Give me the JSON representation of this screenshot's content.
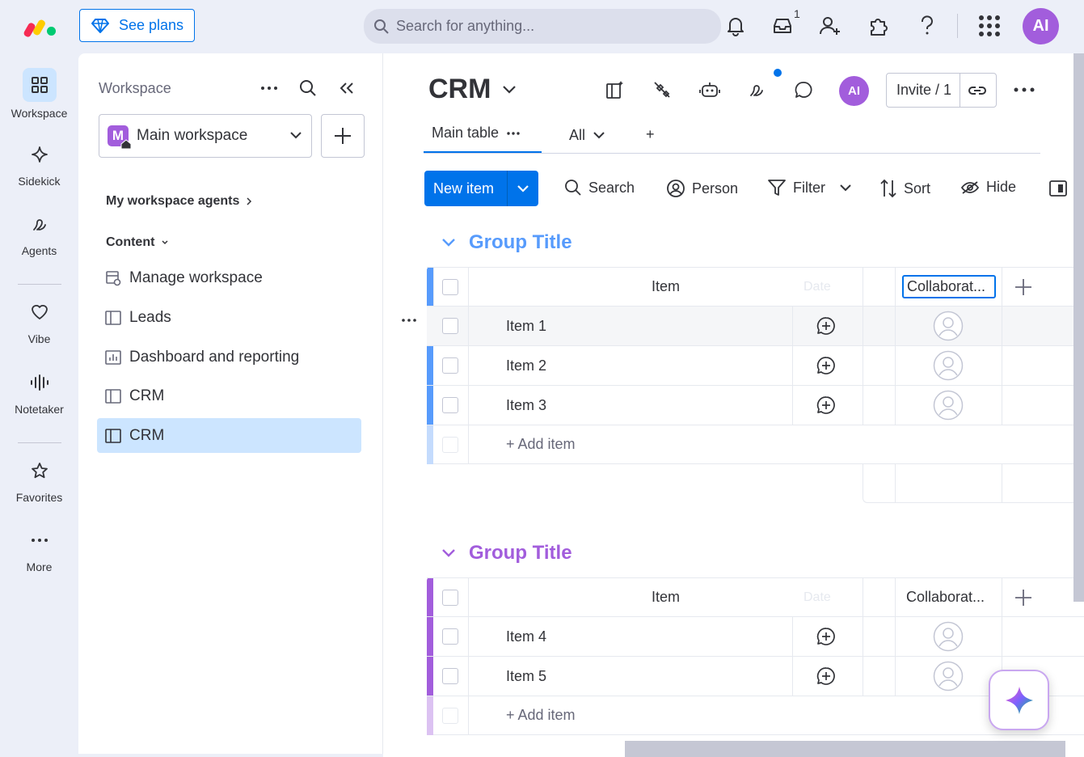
{
  "topbar": {
    "see_plans": "See plans",
    "search_placeholder": "Search for anything...",
    "inbox_badge": "1",
    "avatar_initials": "AI"
  },
  "leftnav": {
    "items": [
      {
        "label": "Workspace",
        "icon": "grid-icon"
      },
      {
        "label": "Sidekick",
        "icon": "sparkle-icon"
      },
      {
        "label": "Agents",
        "icon": "agents-icon"
      },
      {
        "label": "Vibe",
        "icon": "heart-icon"
      },
      {
        "label": "Notetaker",
        "icon": "waveform-icon"
      },
      {
        "label": "Favorites",
        "icon": "star-icon"
      },
      {
        "label": "More",
        "icon": "more-icon"
      }
    ]
  },
  "workspace_panel": {
    "title": "Workspace",
    "selected_workspace": "Main workspace",
    "workspace_initial": "M",
    "agents_link": "My workspace agents",
    "content_label": "Content",
    "tree": [
      {
        "label": "Manage workspace",
        "icon": "manage-icon"
      },
      {
        "label": "Leads",
        "icon": "board-icon"
      },
      {
        "label": "Dashboard and reporting",
        "icon": "dashboard-icon"
      },
      {
        "label": "CRM",
        "icon": "board-icon"
      },
      {
        "label": "CRM",
        "icon": "board-icon",
        "active": true
      }
    ]
  },
  "board": {
    "title": "CRM",
    "avatar_initials": "AI",
    "invite_label": "Invite / 1",
    "tabs": {
      "main": "Main table",
      "all": "All",
      "add": "+"
    },
    "toolbar": {
      "new_item": "New item",
      "search": "Search",
      "person": "Person",
      "filter": "Filter",
      "sort": "Sort",
      "hide": "Hide"
    },
    "groups": [
      {
        "title": "Group Title",
        "color": "#579bfc",
        "columns": {
          "item": "Item",
          "date": "Date",
          "collab": "Collaborat..."
        },
        "items": [
          "Item 1",
          "Item 2",
          "Item 3"
        ],
        "add_item": "+ Add item"
      },
      {
        "title": "Group Title",
        "color": "#a25ddc",
        "columns": {
          "item": "Item",
          "date": "Date",
          "collab": "Collaborat..."
        },
        "items": [
          "Item 4",
          "Item 5"
        ],
        "add_item": "+ Add item"
      }
    ]
  },
  "colors": {
    "accent": "#0073ea",
    "group1": "#579bfc",
    "group2": "#a25ddc",
    "selected": "#cce5ff"
  }
}
